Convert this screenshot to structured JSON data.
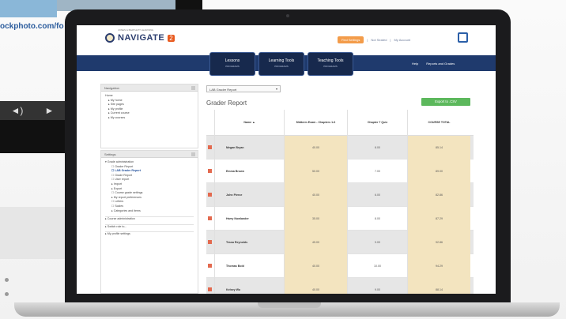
{
  "background": {
    "url_fragment": "ockphoto.com/fo",
    "player_icons": [
      "◄",
      "◄◄",
      "►"
    ]
  },
  "app": {
    "logo_text": "NAVIGATE",
    "logo_badge": "2",
    "logo_supertitle": "JONES & BARTLETT LEARNING",
    "top_links": [
      "Find Settings",
      "Not Seated",
      "My Account"
    ],
    "nav_tabs": [
      {
        "label": "Lessons",
        "sub": "PROGRAMS"
      },
      {
        "label": "Learning Tools",
        "sub": "PROGRAMS"
      },
      {
        "label": "Teaching Tools",
        "sub": "PROGRAMS"
      }
    ],
    "nav_right": [
      "Help",
      "Reports and Grades"
    ]
  },
  "navigation_block": {
    "title": "Navigation",
    "items": [
      "Home",
      "▸ My home",
      "▸ Site pages",
      "▸ My profile",
      "▸ Current course",
      "▸ My courses"
    ]
  },
  "settings_block": {
    "title": "Settings",
    "items": [
      "▾ Grade administration",
      "☐ Grader Report",
      "☐ LAB Grader Report",
      "☐ Grade Report",
      "☐ User report",
      "▸ Import",
      "▸ Export",
      "☐ Course grade settings",
      "▸ My report preferences",
      "☐ Letters",
      "☐ Scales",
      "▸ Categories and items",
      "",
      "▸ Course administration",
      "",
      "▸ Switch role to...",
      "",
      "▸ My profile settings"
    ]
  },
  "report_select": {
    "value": "LAB Grader Report"
  },
  "page_title": "Grader Report",
  "export_button": "Export to .CSV",
  "table": {
    "headers": [
      "Name ▲",
      "Midterm Exam - Chapters 1-6",
      "Chapter 7 Quiz",
      "COURSE TOTAL"
    ],
    "rows": [
      [
        "Megan Bryan",
        "40.00",
        "8.00",
        "85.14"
      ],
      [
        "Emma Brown",
        "50.00",
        "7.00",
        "89.00"
      ],
      [
        "John Pierce",
        "40.00",
        "6.00",
        "82.86"
      ],
      [
        "Harry Nowlander",
        "35.00",
        "8.00",
        "87.29"
      ],
      [
        "Tessa Reynolds",
        "45.00",
        "9.00",
        "92.86"
      ],
      [
        "Thomas Bold",
        "40.00",
        "10.00",
        "94.29"
      ],
      [
        "Kelsey Wu",
        "40.00",
        "9.00",
        "88.14"
      ]
    ]
  }
}
